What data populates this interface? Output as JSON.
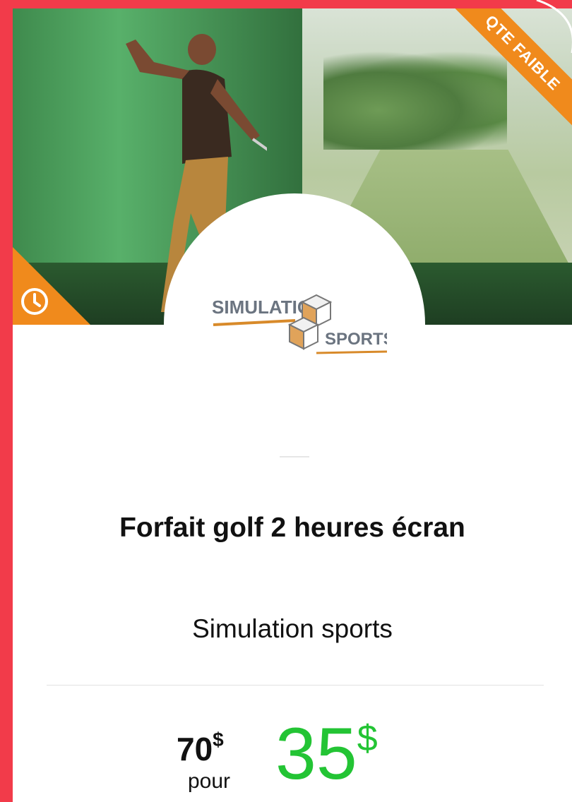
{
  "badge": {
    "label": "QTE FAIBLE"
  },
  "deal": {
    "title": "Forfait golf 2 heures écran",
    "merchant": "Simulation sports",
    "original_price": "70",
    "original_currency": "$",
    "pour_label": "pour",
    "sale_price": "35",
    "sale_currency": "$"
  },
  "logo": {
    "line1": "SIMULATION",
    "line2": "SPORTS"
  },
  "colors": {
    "background": "#f23b4a",
    "accent_orange": "#f08a1c",
    "price_green": "#23c434"
  },
  "icons": [
    "clock-icon",
    "cube-logo-icon"
  ]
}
